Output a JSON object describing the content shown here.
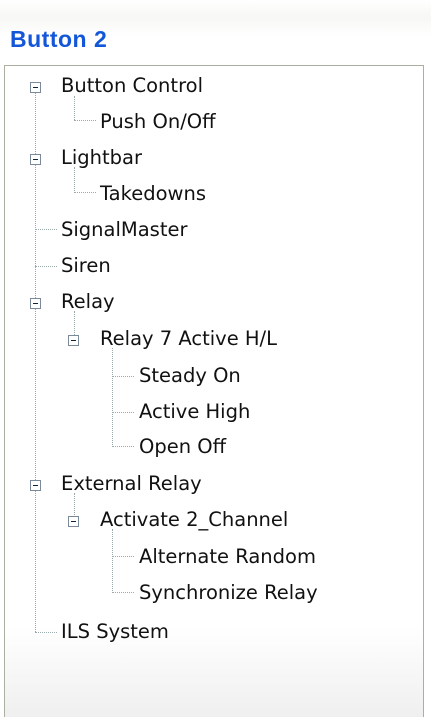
{
  "panel_title": "Button 2",
  "tree": {
    "button_control": "Button Control",
    "push_on_off": "Push On/Off",
    "lightbar": "Lightbar",
    "takedowns": "Takedowns",
    "signalmaster": "SignalMaster",
    "siren": "Siren",
    "relay": "Relay",
    "relay7": "Relay 7 Active H/L",
    "steady_on": "Steady On",
    "active_high": "Active High",
    "open_off": "Open Off",
    "external_relay": "External Relay",
    "activate2": "Activate 2_Channel",
    "alternate_random": "Alternate Random",
    "synchronize_relay": "Synchronize Relay",
    "ils_system": "ILS System"
  },
  "colors": {
    "title": "#1356d8",
    "border": "#a8b0a0"
  }
}
